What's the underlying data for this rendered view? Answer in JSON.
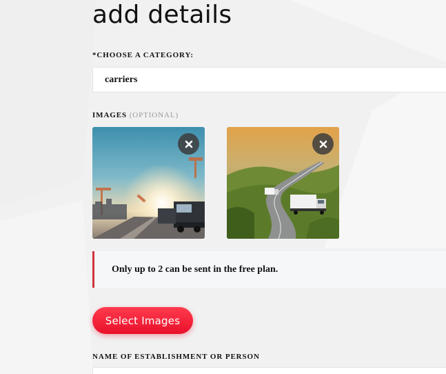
{
  "page": {
    "title": "add details"
  },
  "category": {
    "label": "*CHOOSE A CATEGORY:",
    "value": "carriers"
  },
  "images": {
    "label": "IMAGES",
    "optional_tag": "(OPTIONAL)",
    "items": [
      {
        "subject": "truck at port with cranes at sunset",
        "remove_icon": "close-icon"
      },
      {
        "subject": "trucks on curving highway through green hills",
        "remove_icon": "close-icon"
      }
    ]
  },
  "notice": {
    "text": "Only up to 2 can be sent in the free plan."
  },
  "select_images_button": {
    "label": "Select Images"
  },
  "name_field": {
    "label": "NAME OF ESTABLISHMENT OR PERSON",
    "value": ""
  },
  "colors": {
    "accent": "#e8102a",
    "notice_border": "#d0343a",
    "background": "#f1f1f2"
  }
}
